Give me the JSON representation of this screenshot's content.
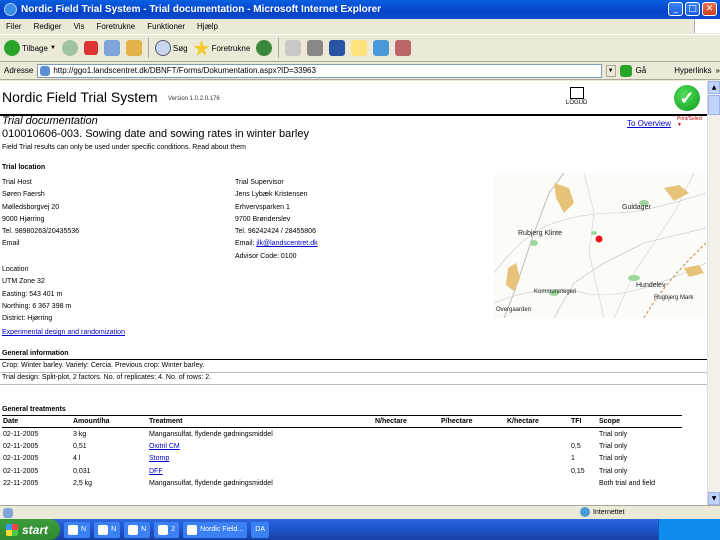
{
  "window": {
    "title": "Nordic Field Trial System - Trial documentation - Microsoft Internet Explorer"
  },
  "menu": [
    "Filer",
    "Rediger",
    "Vis",
    "Foretrukne",
    "Funktioner",
    "Hjælp"
  ],
  "toolbar": {
    "back": "Tilbage",
    "search": "Søg",
    "favorites": "Foretrukne"
  },
  "address": {
    "label": "Adresse",
    "url": "http://ggo1.landscentret.dk/DBNFT/Forms/Dokumentation.aspx?ID=33963",
    "go": "Gå",
    "links": "Hyperlinks",
    "more": "»"
  },
  "page": {
    "site_title": "Nordic Field Trial System",
    "version": "Version 1.0.2.0.176",
    "logout": "LOGUD",
    "section_title": "Trial documentation",
    "trial_title": "010010606-003. Sowing date and sowing rates in winter barley",
    "overview_link": "To Overview",
    "print_label": "Print/Select",
    "notice": "Field Trial results can only be used under specific conditions. Read about them",
    "location_head": "Trial location",
    "host": [
      "Trial Host",
      "Søren Faersh",
      "Mølledsborgvej 20",
      "9000 Hjørring",
      "Tel. 98980263/20435536",
      "Email"
    ],
    "supervisor_lines": [
      "Trial Supervisor",
      "Jens Lybæk Kristensen",
      "Erhvervsparken 1",
      "9700 Brønderslev"
    ],
    "supervisor_tel": "Tel. 96242424 / 28455806",
    "supervisor_email_label": "Email:",
    "supervisor_email": "jlk@landscentret.dk",
    "advisor": "Advisor Code: 0100",
    "location": [
      "Location",
      "UTM Zone 32",
      "Easting: 543 401 m",
      "Northing: 6 367 398 m",
      "District: Hjørring"
    ],
    "plan_link": "Experimental design and randomization",
    "general_head": "General information",
    "general_crop": "Crop: Winter barley. Variety: Cercia. Previous crop: Winter barley.",
    "general_design": "Trial design: Split-plot, 2 factors. No. of replicates: 4. No. of rows: 2.",
    "treat_head": "General treatments",
    "map_labels": [
      "Guldager",
      "Rubjerg Klinte",
      "Hundelev",
      "Rugbjerg Mark",
      "Kommunetegeri",
      "Overgaarden"
    ]
  },
  "table": {
    "headers": [
      "Date",
      "Amount/ha",
      "Treatment",
      "N/hectare",
      "P/hectare",
      "K/hectare",
      "TFI",
      "Scope"
    ],
    "rows": [
      [
        "02-11-2005",
        "3 kg",
        "Mangansulfat, flydende gødningsmiddel",
        "",
        "",
        "",
        "",
        "Trial only"
      ],
      [
        "02-11-2005",
        "0,51",
        "Oxitril CM",
        "",
        "",
        "",
        "0,5",
        "Trial only"
      ],
      [
        "02-11-2005",
        "4 l",
        "Stomp",
        "",
        "",
        "",
        "1",
        "Trial only"
      ],
      [
        "02-11-2005",
        "0,031",
        "DFF",
        "",
        "",
        "",
        "0,15",
        "Trial only"
      ],
      [
        "22-11-2005",
        "2,5 kg",
        "Mangansulfat, flydende gødningsmiddel",
        "",
        "",
        "",
        "",
        "Both trial and field"
      ]
    ]
  },
  "status": {
    "zone": "Internettet"
  },
  "taskbar": {
    "start": "start",
    "tasks": [
      "N",
      "N",
      "N",
      "2",
      "Nordic Field...",
      "DA"
    ]
  },
  "colors": {
    "link": "#0000cc",
    "marker": "#e8141c",
    "accent_green": "#149c1e"
  }
}
